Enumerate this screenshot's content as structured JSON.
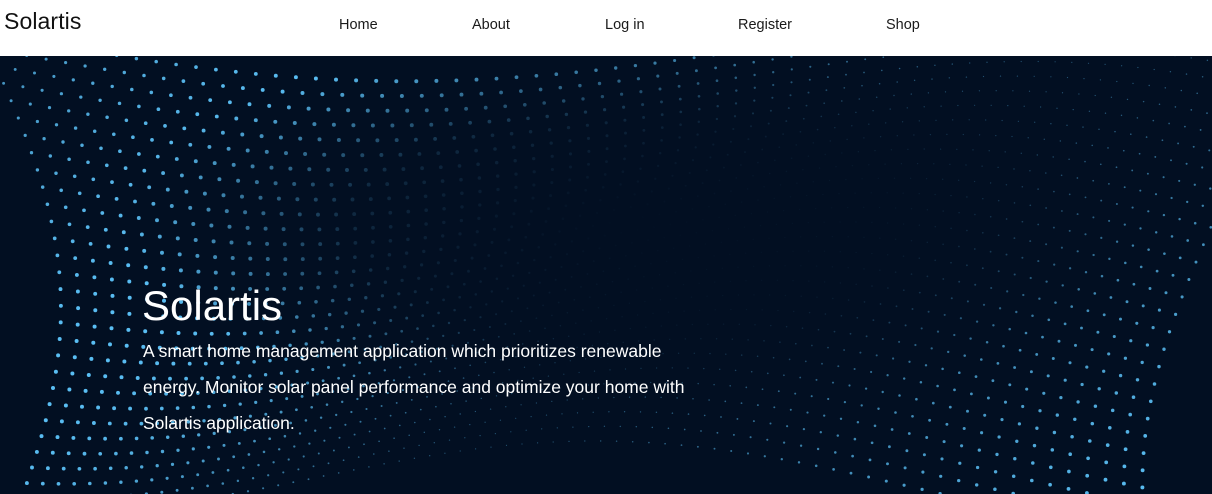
{
  "navbar": {
    "brand": "Solartis",
    "links": [
      {
        "label": "Home"
      },
      {
        "label": "About"
      },
      {
        "label": "Log in"
      },
      {
        "label": "Register"
      },
      {
        "label": "Shop"
      }
    ]
  },
  "hero": {
    "title": "Solartis",
    "description": "A smart home management application which prioritizes renewable energy. Monitor solar panel performance and optimize your home with Solartis application.",
    "background_color": "#020f22",
    "dot_color": "#5fc8ff"
  }
}
